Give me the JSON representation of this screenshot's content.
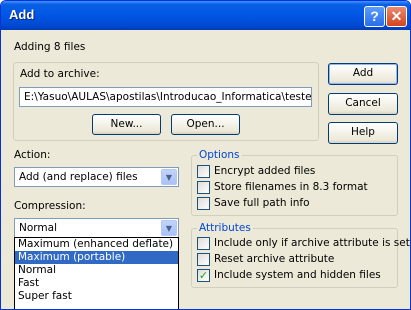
{
  "window": {
    "title": "Add",
    "help_label": "?",
    "close_label": "✕"
  },
  "status": "Adding 8 files",
  "archive": {
    "label": "Add to archive:",
    "path": "E:\\Yasuo\\AULAS\\apostilas\\Introducao_Informatica\\teste",
    "new_label": "New...",
    "open_label": "Open..."
  },
  "buttons": {
    "add": "Add",
    "cancel": "Cancel",
    "help": "Help"
  },
  "action": {
    "label": "Action:",
    "value": "Add (and replace) files"
  },
  "compression": {
    "label": "Compression:",
    "value": "Normal",
    "options": [
      "Maximum (enhanced deflate)",
      "Maximum (portable)",
      "Normal",
      "Fast",
      "Super fast"
    ],
    "highlighted_index": 1
  },
  "options_group": {
    "title": "Options",
    "items": [
      {
        "label": "Encrypt added files",
        "checked": false
      },
      {
        "label": "Store filenames in 8.3 format",
        "checked": false
      },
      {
        "label": "Save full path info",
        "checked": false
      }
    ]
  },
  "attributes_group": {
    "title": "Attributes",
    "items": [
      {
        "label": "Include only if archive attribute is set",
        "checked": false
      },
      {
        "label": "Reset archive attribute",
        "checked": false
      },
      {
        "label": "Include system and hidden files",
        "checked": true
      }
    ]
  },
  "colors": {
    "titlebar": "#0056e4",
    "dialog_bg": "#ece9d8",
    "group_title": "#0046d5",
    "selection": "#316ac5",
    "checkmark": "#21a121"
  }
}
